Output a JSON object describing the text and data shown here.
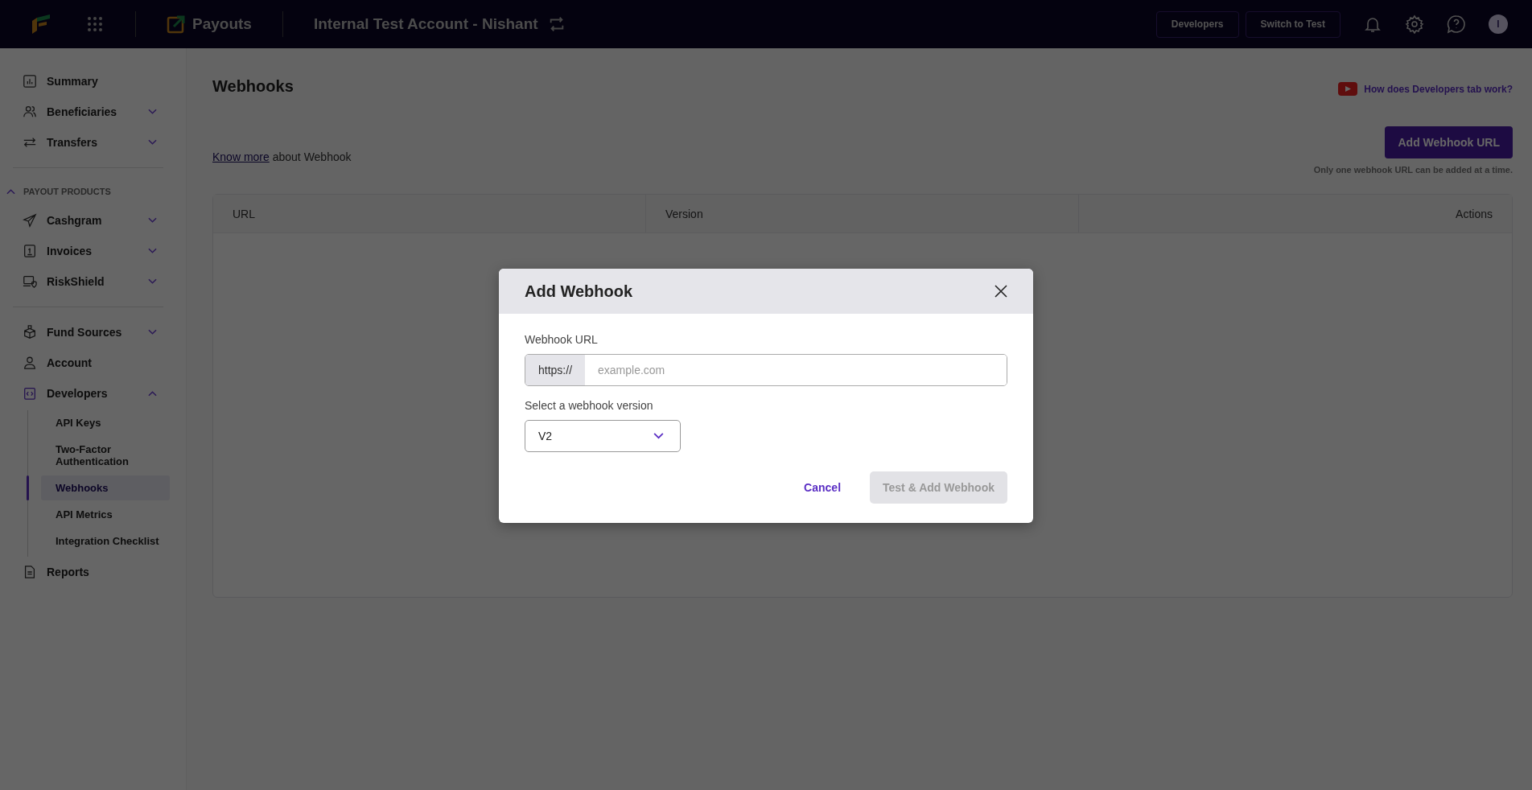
{
  "topbar": {
    "app_name": "Payouts",
    "account_name": "Internal Test Account - Nishant",
    "buttons": [
      "Developers",
      "Switch to Test"
    ],
    "avatar_initial": "I"
  },
  "sidebar": {
    "sections": [
      {
        "items": [
          {
            "label": "Summary",
            "selected": false
          },
          {
            "label": "Beneficiaries",
            "selected": false,
            "expanded": false
          },
          {
            "label": "Transfers",
            "selected": false,
            "expanded": false
          }
        ]
      },
      {
        "heading": "PAYOUT PRODUCTS",
        "expanded": true,
        "items": [
          {
            "label": "Cashgram",
            "selected": false,
            "expanded": false
          },
          {
            "label": "Invoices",
            "selected": false,
            "expanded": false
          },
          {
            "label": "RiskShield",
            "selected": false,
            "expanded": false
          }
        ]
      },
      {
        "items": [
          {
            "label": "Fund Sources",
            "selected": false,
            "expanded": false
          },
          {
            "label": "Account",
            "selected": false
          },
          {
            "label": "Developers",
            "selected": false,
            "expanded": true,
            "children": [
              {
                "label": "API Keys",
                "selected": false
              },
              {
                "label": "Two-Factor Authentication",
                "selected": false
              },
              {
                "label": "Webhooks",
                "selected": true
              },
              {
                "label": "API Metrics",
                "selected": false
              },
              {
                "label": "Integration Checklist",
                "selected": false
              }
            ]
          },
          {
            "label": "Reports",
            "selected": false
          }
        ]
      }
    ]
  },
  "page": {
    "title": "Webhooks",
    "help_link": "How does Developers tab work?",
    "know_more_link": "Know more",
    "know_more_text": "about Webhook",
    "add_button": "Add Webhook URL",
    "note": "Only one webhook URL can be added at a time.",
    "table": {
      "columns": [
        "URL",
        "Version",
        "Actions"
      ]
    }
  },
  "modal": {
    "title": "Add Webhook",
    "url_label": "Webhook URL",
    "url_prefix": "https://",
    "url_placeholder": "example.com",
    "version_label": "Select a webhook version",
    "version_value": "V2",
    "cancel": "Cancel",
    "submit": {
      "label": "Test & Add Webhook",
      "disabled": true
    }
  }
}
